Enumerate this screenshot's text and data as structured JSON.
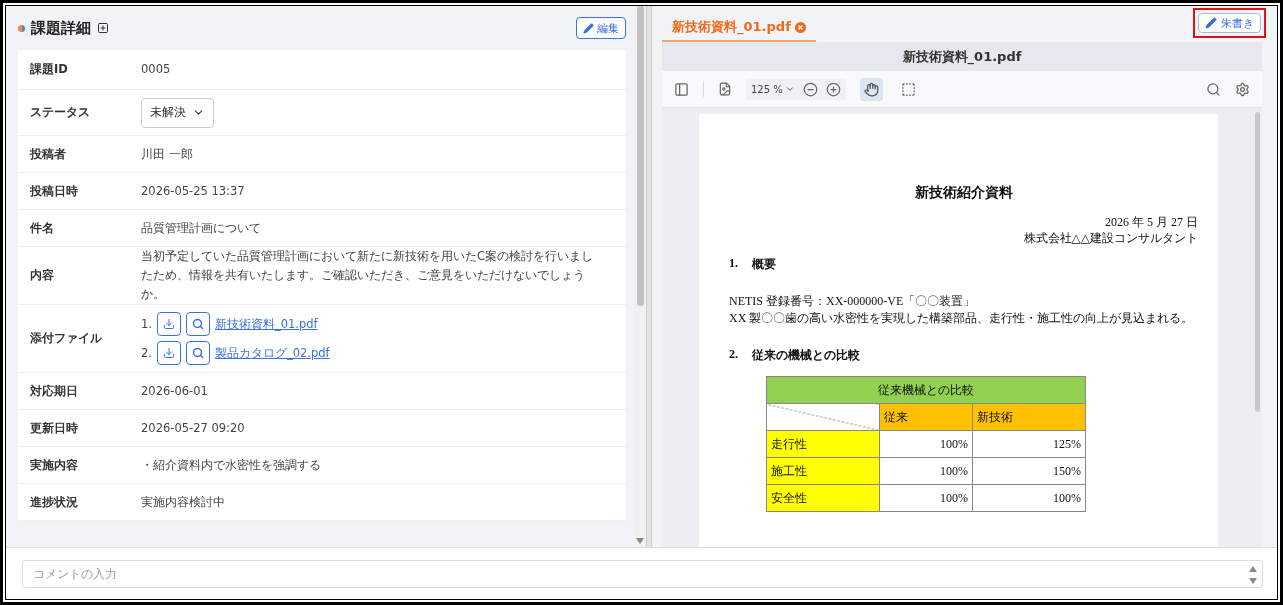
{
  "detail_panel": {
    "title": "課題詳細",
    "edit_button": "編集",
    "fields": [
      {
        "kind": "text",
        "label": "課題ID",
        "value": "0005"
      },
      {
        "kind": "select",
        "label": "ステータス",
        "value": "未解決"
      },
      {
        "kind": "text",
        "label": "投稿者",
        "value": "川田 一郎"
      },
      {
        "kind": "text",
        "label": "投稿日時",
        "value": "2026-05-25 13:37"
      },
      {
        "kind": "text",
        "label": "件名",
        "value": "品質管理計画について"
      },
      {
        "kind": "text",
        "label": "内容",
        "value": "当初予定していた品質管理計画において新たに新技術を用いたC案の検討を行いましたため、情報を共有いたします。ご確認いただき、ご意見をいただけないでしょうか。"
      },
      {
        "kind": "files",
        "label": "添付ファイル",
        "files": [
          {
            "number": "1.",
            "name": "新技術資料_01.pdf"
          },
          {
            "number": "2.",
            "name": "製品カタログ_02.pdf"
          }
        ]
      },
      {
        "kind": "text",
        "label": "対応期日",
        "value": "2026-06-01"
      },
      {
        "kind": "text",
        "label": "更新日時",
        "value": "2026-05-27 09:20"
      },
      {
        "kind": "text",
        "label": "実施内容",
        "value": "・紹介資料内で水密性を強調する"
      },
      {
        "kind": "text",
        "label": "進捗状況",
        "value": "実施内容検討中"
      }
    ]
  },
  "viewer": {
    "tabs": [
      {
        "label": "新技術資料_01.pdf",
        "selected": true
      }
    ],
    "annotate_button": "朱書き",
    "document_title": "新技術資料_01.pdf",
    "zoom": "125 %",
    "tools": [
      {
        "kind": "hand",
        "selected": true
      },
      {
        "kind": "marquee",
        "selected": false
      }
    ],
    "document": {
      "title": "新技術紹介資料",
      "date": "2026 年 5 月 27 日",
      "company": "株式会社△△建設コンサルタント",
      "sections": [
        {
          "number": "1.",
          "heading": "概要",
          "paragraphs": [
            "NETIS 登録番号：XX-000000-VE「〇〇装置」",
            "XX 製〇〇歯の高い水密性を実現した構築部品、走行性・施工性の向上が見込まれる。"
          ]
        },
        {
          "number": "2.",
          "heading": "従来の機械との比較",
          "table": {
            "caption": "従来機械との比較",
            "columns": [
              "従来",
              "新技術"
            ],
            "rows": [
              {
                "label": "走行性",
                "values": [
                  "100%",
                  "125%"
                ]
              },
              {
                "label": "施工性",
                "values": [
                  "100%",
                  "150%"
                ]
              },
              {
                "label": "安全性",
                "values": [
                  "100%",
                  "100%"
                ]
              }
            ]
          }
        }
      ]
    }
  },
  "comment": {
    "placeholder": "コメントの入力"
  }
}
